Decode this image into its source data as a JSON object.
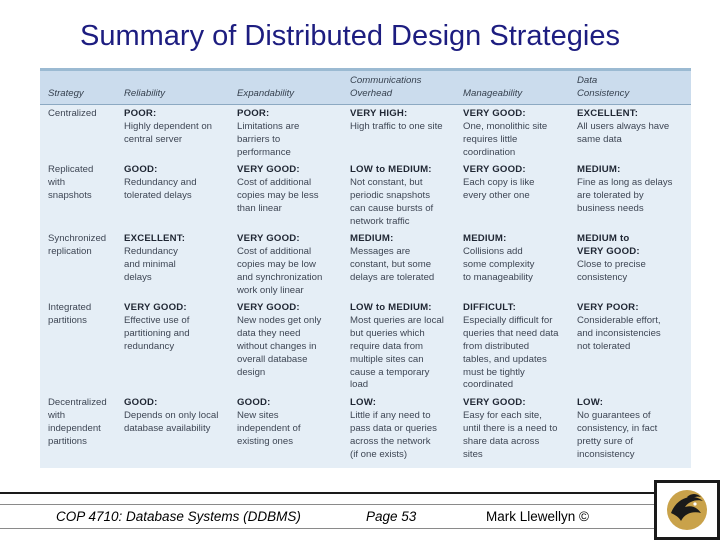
{
  "slide": {
    "title": "Summary of Distributed Design Strategies"
  },
  "table": {
    "headers": [
      {
        "lines": [
          "Strategy"
        ]
      },
      {
        "lines": [
          "Reliability"
        ]
      },
      {
        "lines": [
          "Expandability"
        ]
      },
      {
        "lines": [
          "Communications",
          "Overhead"
        ]
      },
      {
        "lines": [
          "Manageability"
        ]
      },
      {
        "lines": [
          "Data",
          "Consistency"
        ]
      }
    ],
    "rows": [
      {
        "strategy": [
          "Centralized"
        ],
        "cells": [
          {
            "rating": "POOR:",
            "lines": [
              "Highly dependent on",
              "central server"
            ]
          },
          {
            "rating": "POOR:",
            "lines": [
              "Limitations are",
              "barriers to",
              "performance"
            ]
          },
          {
            "rating": "VERY HIGH:",
            "lines": [
              "High traffic to one site"
            ]
          },
          {
            "rating": "VERY GOOD:",
            "lines": [
              "One, monolithic site",
              "requires little",
              "coordination"
            ]
          },
          {
            "rating": "EXCELLENT:",
            "lines": [
              "All users always have",
              "same data"
            ]
          }
        ]
      },
      {
        "strategy": [
          "Replicated",
          "with",
          "snapshots"
        ],
        "cells": [
          {
            "rating": "GOOD:",
            "lines": [
              "Redundancy and",
              "tolerated delays"
            ]
          },
          {
            "rating": "VERY GOOD:",
            "lines": [
              "Cost of additional",
              "copies may be less",
              "than linear"
            ]
          },
          {
            "rating": "LOW to MEDIUM:",
            "lines": [
              "Not constant, but",
              "periodic snapshots",
              "can cause bursts of",
              "network traffic"
            ]
          },
          {
            "rating": "VERY GOOD:",
            "lines": [
              "Each copy is like",
              "every other one"
            ]
          },
          {
            "rating": "MEDIUM:",
            "lines": [
              "Fine as long as delays",
              "are tolerated by",
              "business needs"
            ]
          }
        ]
      },
      {
        "strategy": [
          "Synchronized",
          "replication"
        ],
        "cells": [
          {
            "rating": "EXCELLENT:",
            "lines": [
              "Redundancy",
              "and minimal",
              "delays"
            ]
          },
          {
            "rating": "VERY GOOD:",
            "lines": [
              "Cost of additional",
              "copies may be low",
              "and synchronization",
              "work only linear"
            ]
          },
          {
            "rating": "MEDIUM:",
            "lines": [
              "Messages are",
              "constant, but some",
              "delays are tolerated"
            ]
          },
          {
            "rating": "MEDIUM:",
            "lines": [
              "Collisions add",
              "some complexity",
              "to manageability"
            ]
          },
          {
            "rating": "MEDIUM to\nVERY GOOD:",
            "lines": [
              "Close to precise",
              "consistency"
            ]
          }
        ]
      },
      {
        "strategy": [
          "Integrated",
          "partitions"
        ],
        "cells": [
          {
            "rating": "VERY GOOD:",
            "lines": [
              "Effective use of",
              "partitioning and",
              "redundancy"
            ]
          },
          {
            "rating": "VERY GOOD:",
            "lines": [
              "New nodes get only",
              "data they need",
              "without changes in",
              "overall database",
              "design"
            ]
          },
          {
            "rating": "LOW to MEDIUM:",
            "lines": [
              "Most queries are local",
              "but queries which",
              "require data from",
              "multiple sites can",
              "cause a temporary",
              "load"
            ]
          },
          {
            "rating": "DIFFICULT:",
            "lines": [
              "Especially difficult for",
              "queries that need data",
              "from distributed",
              "tables, and updates",
              "must be tightly",
              "coordinated"
            ]
          },
          {
            "rating": "VERY POOR:",
            "lines": [
              "Considerable effort,",
              "and inconsistencies",
              "not tolerated"
            ]
          }
        ]
      },
      {
        "strategy": [
          "Decentralized",
          "with",
          "independent",
          "partitions"
        ],
        "cells": [
          {
            "rating": "GOOD:",
            "lines": [
              "Depends on only local",
              "database availability"
            ]
          },
          {
            "rating": "GOOD:",
            "lines": [
              "New sites",
              "independent of",
              "existing ones"
            ]
          },
          {
            "rating": "LOW:",
            "lines": [
              "Little if any need to",
              "pass data or queries",
              "across the network",
              "(if one exists)"
            ]
          },
          {
            "rating": "VERY GOOD:",
            "lines": [
              "Easy for each site,",
              "until there is a need to",
              "share data across",
              "sites"
            ]
          },
          {
            "rating": "LOW:",
            "lines": [
              "No guarantees of",
              "consistency, in fact",
              "pretty sure of",
              "inconsistency"
            ]
          }
        ]
      }
    ]
  },
  "footer": {
    "course": "COP 4710: Database Systems  (DDBMS)",
    "page": "Page 53",
    "author": "Mark Llewellyn ©"
  },
  "colors": {
    "title": "#1d1d80",
    "table_bg": "#e5eef6",
    "header_bg": "#cbdced",
    "logo_gold": "#c9a24a"
  },
  "icons": {
    "logo": "ucf-pegasus-logo"
  }
}
